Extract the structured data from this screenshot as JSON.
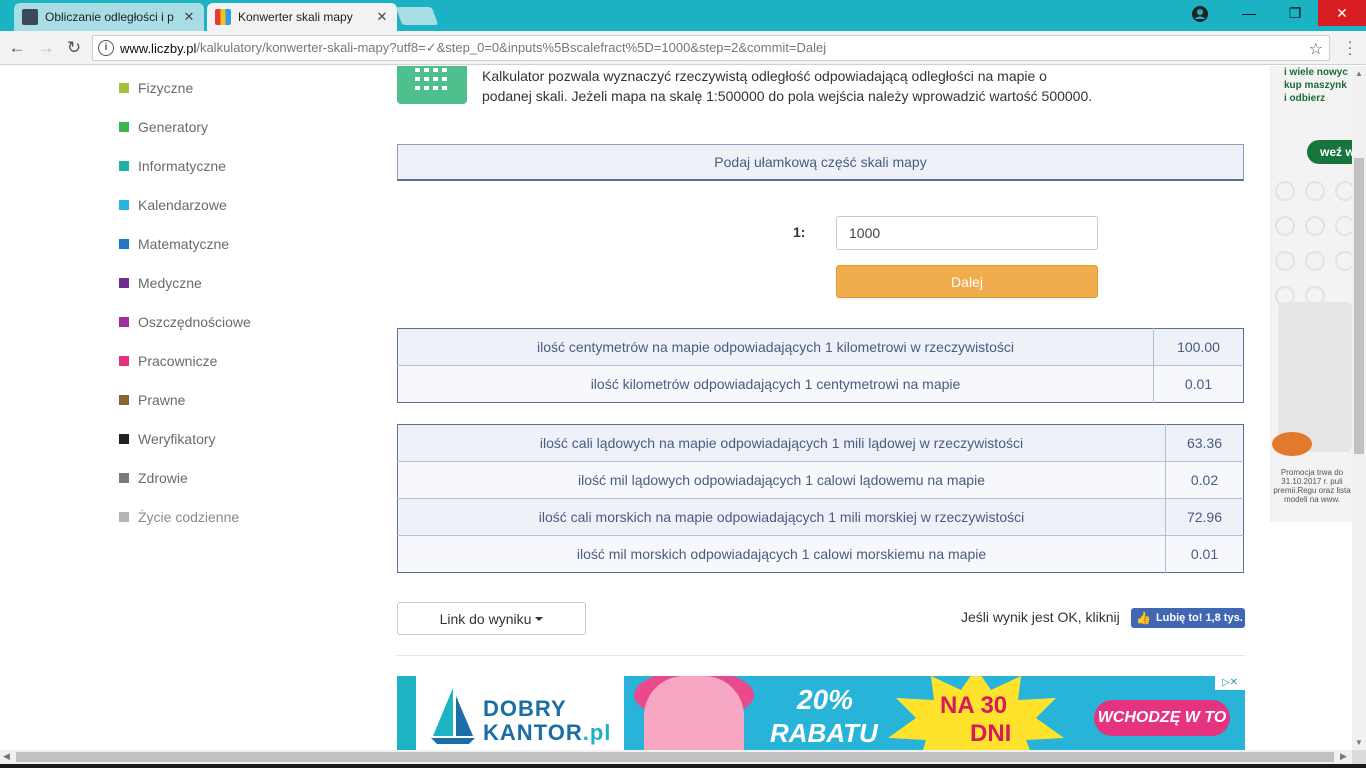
{
  "browser": {
    "tabs": [
      {
        "title": "Obliczanie odległości i p",
        "favicon_color": "#3a4a5a",
        "active": false
      },
      {
        "title": "Konwerter skali mapy",
        "favicon_color": "#e8a33b",
        "active": true
      }
    ],
    "close_glyph": "✕",
    "window_controls": {
      "minimize": "—",
      "maximize": "❐",
      "close": "✕"
    },
    "nav": {
      "back": "←",
      "forward": "→",
      "reload": "↻"
    },
    "url_host": "www.liczby.pl",
    "url_path": "/kalkulatory/konwerter-skali-mapy?utf8=✓&step_0=0&inputs%5Bscalefract%5D=1000&step=2&commit=Dalej",
    "star_glyph": "☆",
    "info_glyph": "i"
  },
  "sidebar": {
    "categories": [
      {
        "label": "Fizyczne",
        "color": "#a3c13d"
      },
      {
        "label": "Generatory",
        "color": "#3cb54a"
      },
      {
        "label": "Informatyczne",
        "color": "#1db3a0"
      },
      {
        "label": "Kalendarzowe",
        "color": "#2bb3e0"
      },
      {
        "label": "Matematyczne",
        "color": "#1f78c0"
      },
      {
        "label": "Medyczne",
        "color": "#6b2e8e"
      },
      {
        "label": "Oszczędnościowe",
        "color": "#9b2f9e"
      },
      {
        "label": "Pracownicze",
        "color": "#e3317c"
      },
      {
        "label": "Prawne",
        "color": "#8a6536"
      },
      {
        "label": "Weryfikatory",
        "color": "#222222"
      },
      {
        "label": "Zdrowie",
        "color": "#7a7a7a"
      },
      {
        "label": "Życie codzienne",
        "color": "#b5b5b5"
      }
    ]
  },
  "main": {
    "description_line1": "Kalkulator pozwala wyznaczyć rzeczywistą odległość odpowiadającą odległości na mapie o",
    "description_line2": "podanej skali. Jeżeli mapa na skalę 1:500000 do pola wejścia należy wprowadzić wartość 500000.",
    "form_header": "Podaj ułamkową część skali mapy",
    "input_label": "1:",
    "input_value": "1000",
    "submit_label": "Dalej",
    "results_km": [
      {
        "label": "ilość centymetrów na mapie odpowiadających 1 kilometrowi w rzeczywistości",
        "value": "100.00"
      },
      {
        "label": "ilość kilometrów odpowiadających 1 centymetrowi na mapie",
        "value": "0.01"
      }
    ],
    "results_miles": [
      {
        "label": "ilość cali lądowych na mapie odpowiadających 1 mili lądowej w rzeczywistości",
        "value": "63.36"
      },
      {
        "label": "ilość mil lądowych odpowiadających 1 calowi lądowemu na mapie",
        "value": "0.02"
      },
      {
        "label": "ilość cali morskich na mapie odpowiadających 1 mili morskiej w rzeczywistości",
        "value": "72.96"
      },
      {
        "label": "ilość mil morskich odpowiadających 1 calowi morskiemu na mapie",
        "value": "0.01"
      }
    ],
    "link_button": "Link do wyniku",
    "ok_text": "Jeśli wynik jest OK, kliknij",
    "fb_like": "Lubię to! 1,8 tys."
  },
  "ads": {
    "banner": {
      "brand_top": "DOBRY",
      "brand_bottom": "KANTOR",
      "brand_suffix": ".pl",
      "discount": "20%",
      "discount_word": "RABATU",
      "period_top": "NA 30",
      "period_bottom": "DNI",
      "cta": "WCHODZĘ W TO",
      "adchoices": "▷✕"
    },
    "side": {
      "text_lines": [
        "i wiele nowyc",
        "kup maszynk",
        "i odbierz"
      ],
      "pill": "weź w",
      "fine_print": "Promocja trwa do 31.10.2017 r. puli premii.Regu oraz lista modeli na www."
    }
  }
}
